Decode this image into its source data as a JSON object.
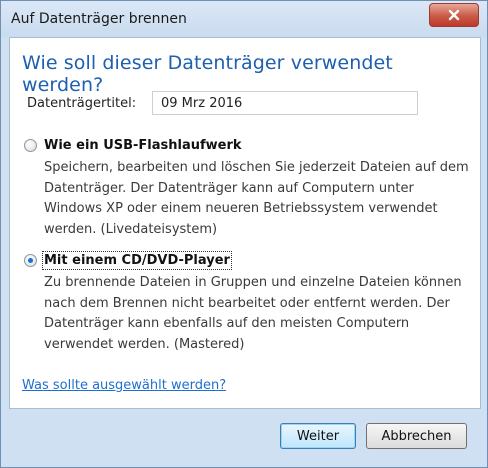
{
  "window": {
    "title": "Auf Datenträger brennen"
  },
  "heading": "Wie soll dieser Datenträger verwendet werden?",
  "disc_title": {
    "label": "Datenträgertitel:",
    "value": "09 Mrz 2016"
  },
  "options": [
    {
      "label": "Wie ein USB-Flashlaufwerk",
      "description": "Speichern, bearbeiten und löschen Sie jederzeit Dateien auf dem Datenträger. Der Datenträger kann auf Computern unter Windows XP oder einem neueren Betriebssystem verwendet werden. (Livedateisystem)",
      "selected": false
    },
    {
      "label": "Mit einem CD/DVD-Player",
      "description": "Zu brennende Dateien in Gruppen und einzelne Dateien können nach dem Brennen nicht bearbeitet oder entfernt werden. Der Datenträger kann ebenfalls auf den meisten Computern verwendet werden. (Mastered)",
      "selected": true
    }
  ],
  "help_link": "Was sollte ausgewählt werden?",
  "buttons": {
    "next": "Weiter",
    "cancel": "Abbrechen"
  },
  "colors": {
    "heading": "#1d5fb0",
    "link": "#1f6fcf",
    "close": "#c0392b"
  }
}
